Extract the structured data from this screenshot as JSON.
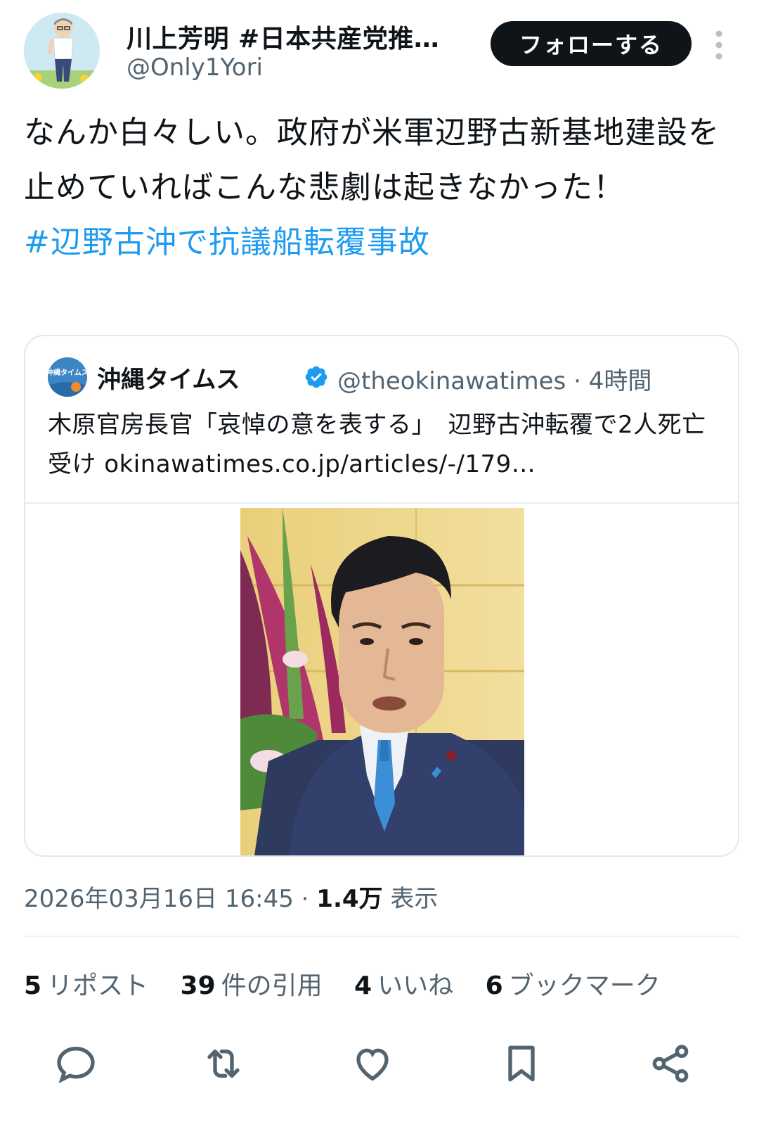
{
  "author": {
    "display_name": "川上芳明 #日本共産党推…",
    "handle": "@Only1Yori",
    "follow_label": "フォローする"
  },
  "tweet": {
    "text": "なんか白々しい。政府が米軍辺野古新基地建設を止めていればこんな悲劇は起きなかった！",
    "hashtag": "#辺野古沖で抗議船転覆事故"
  },
  "quote": {
    "name": "沖縄タイムス",
    "handle": "@theokinawatimes",
    "separator": " · ",
    "time": "4時間",
    "text": "木原官房長官「哀悼の意を表する」　辺野古沖転覆で2人死亡受け okinawatimes.co.jp/articles/-/179…",
    "avatar_text": "沖縄タイムス"
  },
  "meta": {
    "timestamp": "2026年03月16日 16:45",
    "separator": " · ",
    "views": "1.4万",
    "views_label": " 表示"
  },
  "stats": {
    "reposts_num": "5",
    "reposts_label": "リポスト",
    "quotes_num": "39",
    "quotes_label": "件の引用",
    "likes_num": "4",
    "likes_label": "いいね",
    "bookmarks_num": "6",
    "bookmarks_label": "ブックマーク"
  },
  "icons": [
    "more-icon",
    "verified-icon",
    "reply-icon",
    "repost-icon",
    "like-icon",
    "bookmark-icon",
    "share-icon"
  ],
  "colors": {
    "link": "#1d9bf0",
    "text": "#0f1419",
    "muted": "#536471",
    "verified": "#1d9bf0"
  }
}
